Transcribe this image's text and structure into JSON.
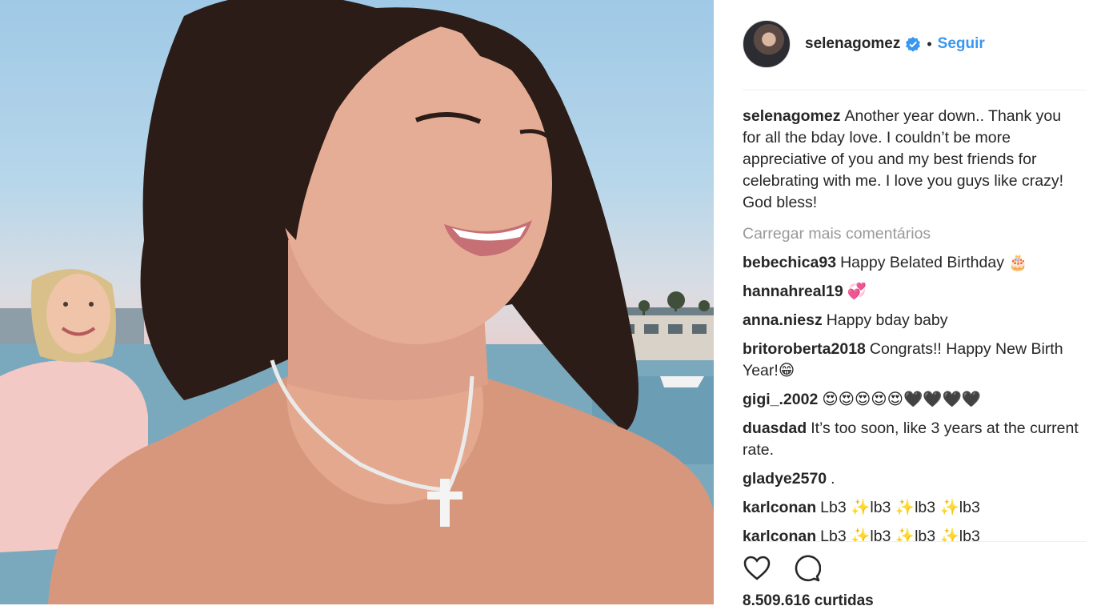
{
  "post": {
    "username": "selenagomez",
    "separator": "•",
    "follow_label": "Seguir",
    "caption_user": "selenagomez",
    "caption_text": "Another year down.. Thank you for all the bday love. I couldn’t be more appreciative of you and my best friends for celebrating with me. I love you guys like crazy! God bless!",
    "load_more_label": "Carregar mais comentários",
    "likes_text": "8.509.616 curtidas"
  },
  "comments": [
    {
      "user": "bebechica93",
      "text": "Happy Belated Birthday 🎂"
    },
    {
      "user": "hannahreal19",
      "text": "💞"
    },
    {
      "user": "anna.niesz",
      "text": "Happy bday baby"
    },
    {
      "user": "britoroberta2018",
      "text": "Congrats!! Happy New Birth Year!😁"
    },
    {
      "user": "gigi_.2002",
      "text": "😍😍😍😍😍🖤🖤🖤🖤"
    },
    {
      "user": "duasdad",
      "text": "It’s too soon, like 3 years at the current rate."
    },
    {
      "user": "gladye2570",
      "text": "."
    },
    {
      "user": "karlconan",
      "text": "Lb3 ✨lb3 ✨lb3 ✨lb3"
    },
    {
      "user": "karlconan",
      "text": "Lb3 ✨lb3 ✨lb3 ✨lb3"
    }
  ],
  "icons": {
    "verified": "verified-badge-icon",
    "like": "heart-icon",
    "comment": "comment-bubble-icon"
  },
  "colors": {
    "accent": "#3897f0",
    "text": "#262626",
    "muted": "#999999",
    "divider": "#efefef"
  }
}
